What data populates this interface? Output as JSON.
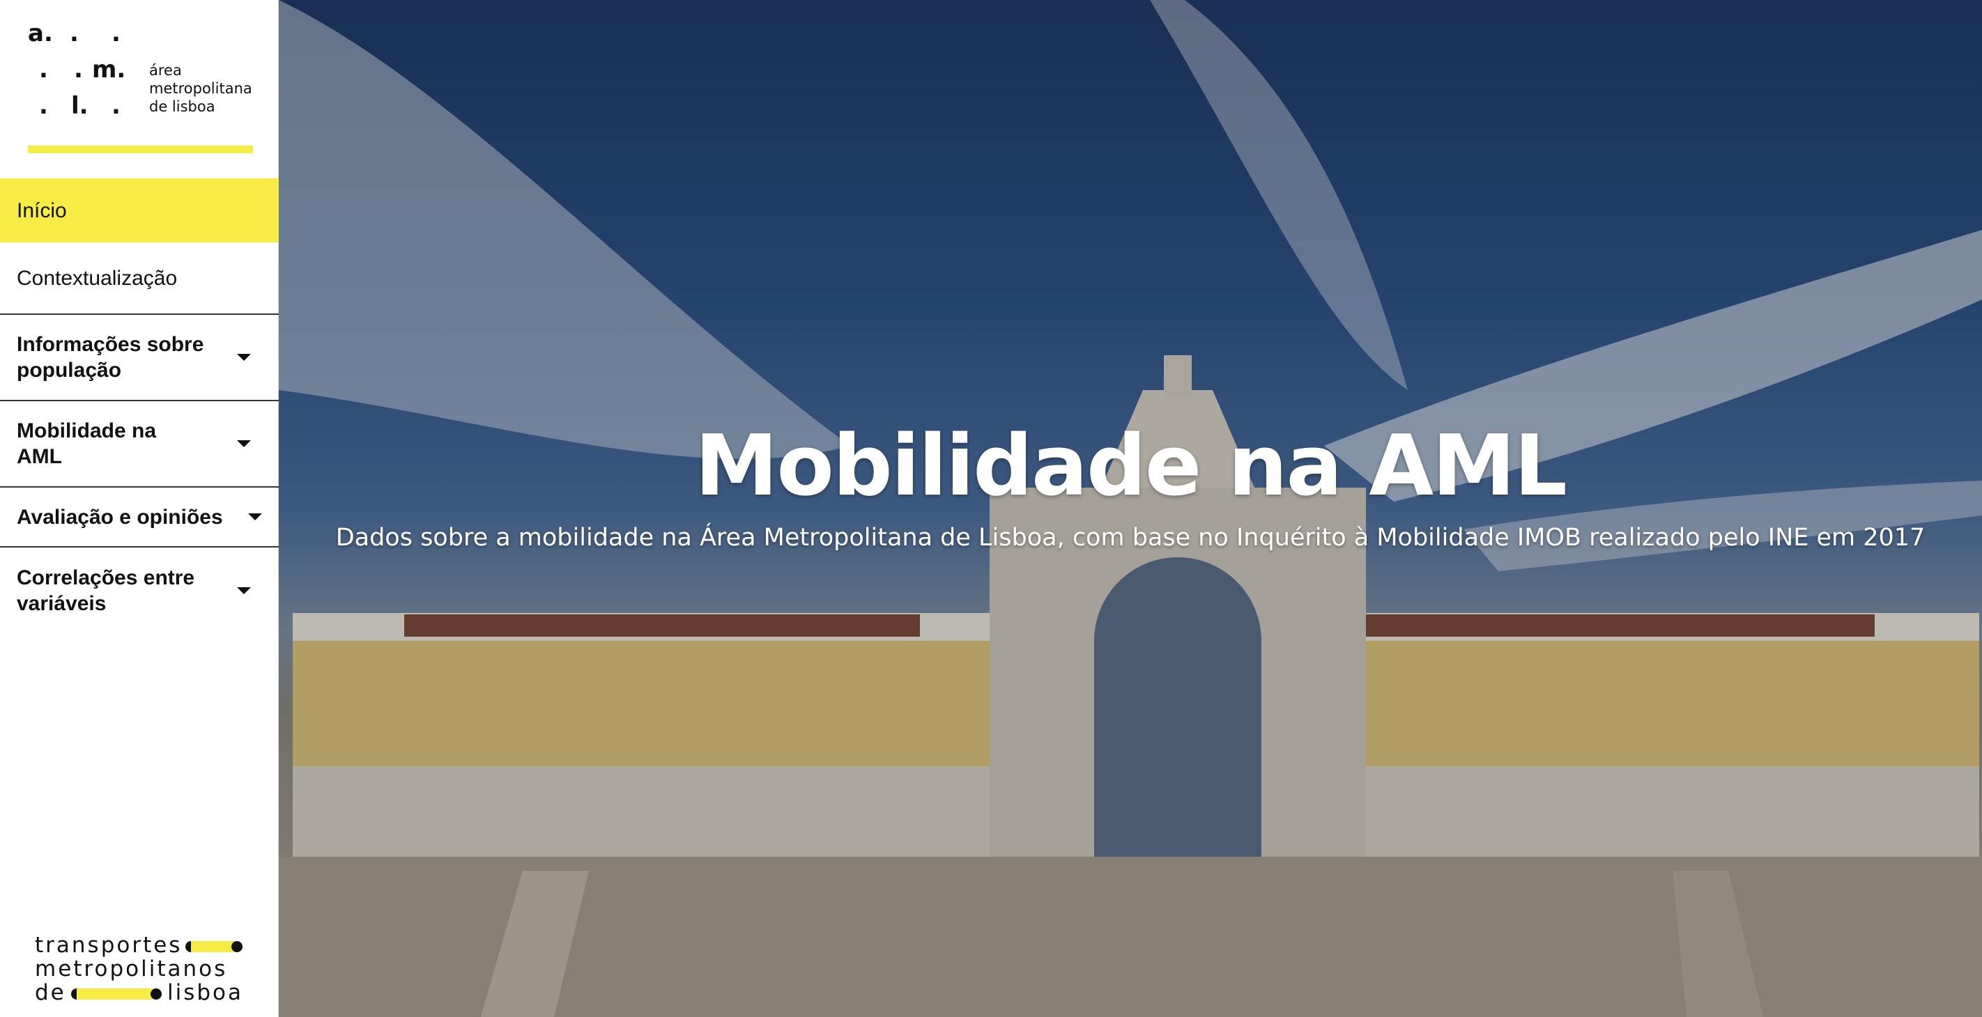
{
  "logo": {
    "mark": {
      "a": "a.",
      "m": "m.",
      "l": "l.",
      "dot": "."
    },
    "text_line1": "área",
    "text_line2": "metropolitana",
    "text_line3": "de lisboa"
  },
  "nav": {
    "items": [
      {
        "label": "Início",
        "active": true,
        "expandable": false
      },
      {
        "label": "Contextualização",
        "active": false,
        "expandable": false
      },
      {
        "label": "Informações sobre população",
        "active": false,
        "expandable": true
      },
      {
        "label": "Mobilidade na AML",
        "active": false,
        "expandable": true
      },
      {
        "label": "Avaliação e opiniões",
        "active": false,
        "expandable": true
      },
      {
        "label": "Correlações entre variáveis",
        "active": false,
        "expandable": true
      }
    ]
  },
  "footer_logo": {
    "line1": "transportes",
    "line2": "metropolitanos",
    "line3a": "de",
    "line3b": "lisboa"
  },
  "hero": {
    "title": "Mobilidade na AML",
    "subtitle": "Dados sobre a mobilidade na Área Metropolitana de Lisboa, com base no Inquérito à Mobilidade IMOB realizado pelo INE em 2017"
  },
  "colors": {
    "accent": "#f7ec45",
    "text": "#111111"
  },
  "icons": [
    "chevron-down-icon"
  ]
}
